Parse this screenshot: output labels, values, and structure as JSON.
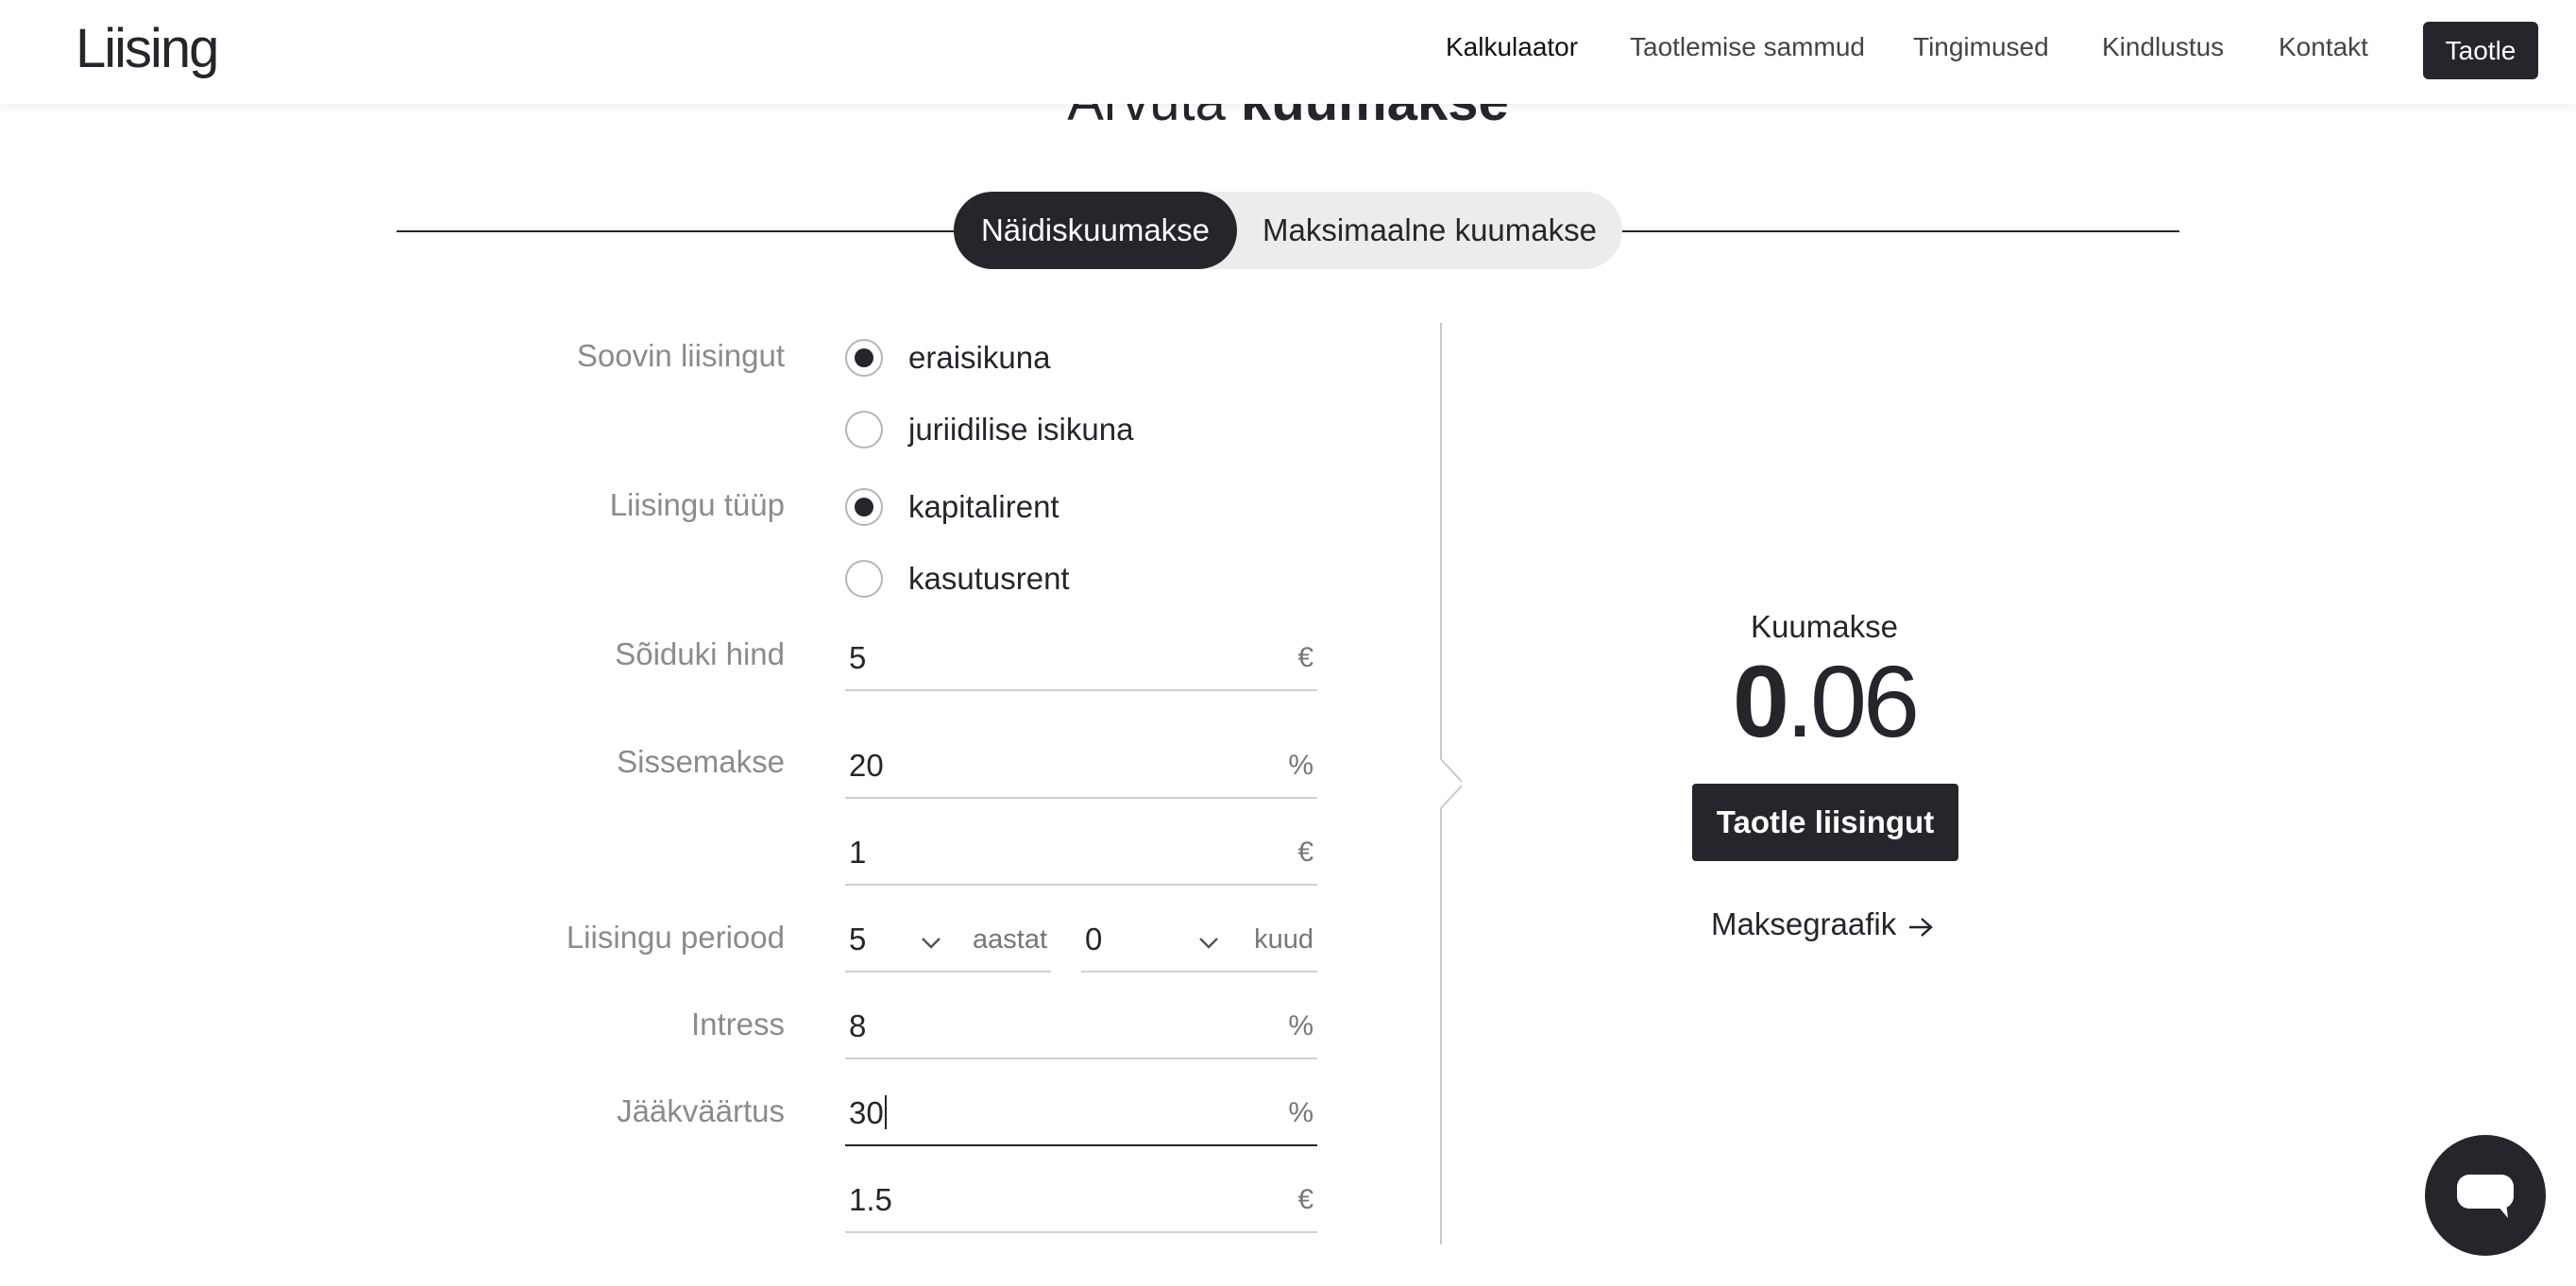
{
  "header": {
    "logo": "Liising",
    "nav": [
      "Kalkulaator",
      "Taotlemise sammud",
      "Tingimused",
      "Kindlustus",
      "Kontakt"
    ],
    "cta_label": "Taotle"
  },
  "page": {
    "heading_light": "Arvuta",
    "heading_bold": "kuumakse"
  },
  "tabs": {
    "active": "Näidiskuumakse",
    "inactive": "Maksimaalne kuumakse"
  },
  "form": {
    "applicant": {
      "label": "Soovin liisingut",
      "options": [
        "eraisikuna",
        "juriidilise isikuna"
      ],
      "selected": "eraisikuna"
    },
    "lease_type": {
      "label": "Liisingu tüüp",
      "options": [
        "kapitalirent",
        "kasutusrent"
      ],
      "selected": "kapitalirent"
    },
    "vehicle_price": {
      "label": "Sõiduki hind",
      "value": "5",
      "unit": "€"
    },
    "down_payment": {
      "label": "Sissemakse",
      "percent": "20",
      "percent_unit": "%",
      "amount": "1",
      "amount_unit": "€"
    },
    "period": {
      "label": "Liisingu periood",
      "years": "5",
      "years_unit": "aastat",
      "months": "0",
      "months_unit": "kuud"
    },
    "interest": {
      "label": "Intress",
      "value": "8",
      "unit": "%"
    },
    "residual": {
      "label": "Jääkväärtus",
      "percent": "30",
      "percent_unit": "%",
      "amount": "1.5",
      "amount_unit": "€"
    }
  },
  "result": {
    "title": "Kuumakse",
    "amount_int": "0",
    "amount_sep": ".",
    "amount_dec": "06",
    "apply_label": "Taotle liisingut",
    "schedule_label": "Maksegraafik"
  },
  "icons": {
    "radio": "radio-icon",
    "chevron": "chevron-down-icon",
    "arrow": "arrow-right-icon",
    "chat": "chat-bubble-icon"
  },
  "colors": {
    "accent": "#25262b",
    "label": "#8b8b8b",
    "toggle_bg": "#ececec"
  }
}
